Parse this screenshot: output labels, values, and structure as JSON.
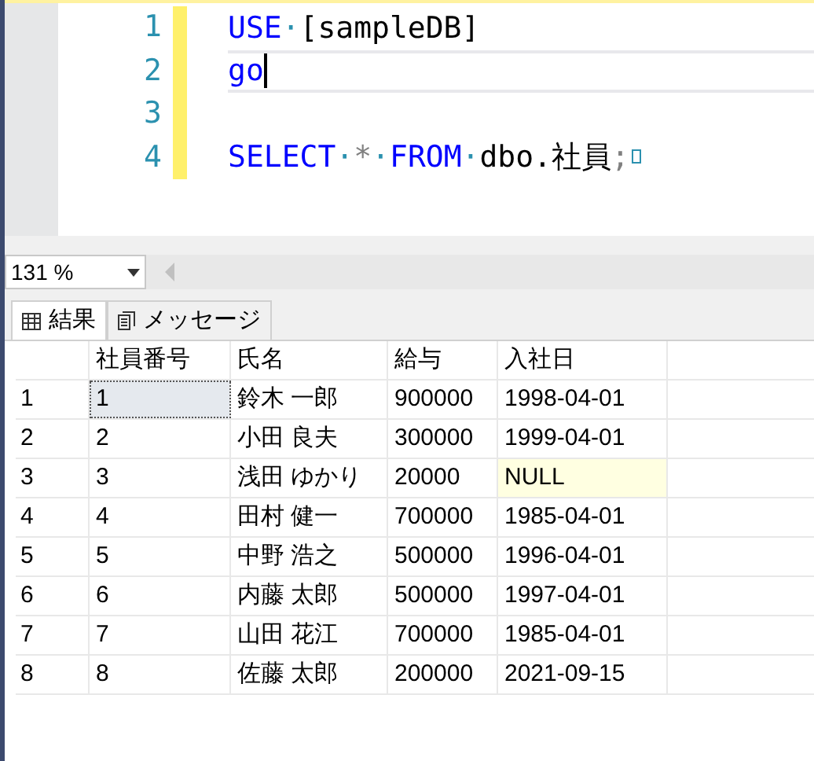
{
  "editor": {
    "lines": [
      {
        "number": "1",
        "caret": false,
        "tokens": [
          {
            "kind": "keyword",
            "text": "USE"
          },
          {
            "kind": "space",
            "text": "·"
          },
          {
            "kind": "plain",
            "text": "[sampleDB]"
          }
        ]
      },
      {
        "number": "2",
        "caret": true,
        "tokens": [
          {
            "kind": "keyword",
            "text": "go"
          }
        ]
      },
      {
        "number": "3",
        "caret": false
      },
      {
        "number": "4",
        "caret": false,
        "tokens": [
          {
            "kind": "keyword",
            "text": "SELECT"
          },
          {
            "kind": "space",
            "text": "·"
          },
          {
            "kind": "operator",
            "text": "*"
          },
          {
            "kind": "space",
            "text": "·"
          },
          {
            "kind": "keyword",
            "text": "FROM"
          },
          {
            "kind": "space",
            "text": "·"
          },
          {
            "kind": "plain",
            "text": "dbo.社員"
          },
          {
            "kind": "operator",
            "text": ";"
          },
          {
            "kind": "eol"
          }
        ]
      }
    ]
  },
  "zoom": {
    "value": "131 %"
  },
  "tabs": [
    {
      "label": "結果",
      "selected": true,
      "kind": "grid"
    },
    {
      "label": "メッセージ",
      "selected": false,
      "kind": "messages"
    }
  ],
  "table": {
    "columns": [
      "社員番号",
      "氏名",
      "給与",
      "入社日"
    ],
    "rows": [
      {
        "number": "1",
        "cells": [
          {
            "text": "1",
            "selected": true,
            "kind": "value"
          },
          {
            "text": "鈴木 一郎",
            "selected": false,
            "kind": "value"
          },
          {
            "text": "900000",
            "selected": false,
            "kind": "value"
          },
          {
            "text": "1998-04-01",
            "selected": false,
            "kind": "value"
          }
        ]
      },
      {
        "number": "2",
        "cells": [
          {
            "text": "2",
            "selected": false,
            "kind": "value"
          },
          {
            "text": "小田 良夫",
            "selected": false,
            "kind": "value"
          },
          {
            "text": "300000",
            "selected": false,
            "kind": "value"
          },
          {
            "text": "1999-04-01",
            "selected": false,
            "kind": "value"
          }
        ]
      },
      {
        "number": "3",
        "cells": [
          {
            "text": "3",
            "selected": false,
            "kind": "value"
          },
          {
            "text": "浅田 ゆかり",
            "selected": false,
            "kind": "value"
          },
          {
            "text": "20000",
            "selected": false,
            "kind": "value"
          },
          {
            "text": "NULL",
            "selected": false,
            "kind": "null"
          }
        ]
      },
      {
        "number": "4",
        "cells": [
          {
            "text": "4",
            "selected": false,
            "kind": "value"
          },
          {
            "text": "田村 健一",
            "selected": false,
            "kind": "value"
          },
          {
            "text": "700000",
            "selected": false,
            "kind": "value"
          },
          {
            "text": "1985-04-01",
            "selected": false,
            "kind": "value"
          }
        ]
      },
      {
        "number": "5",
        "cells": [
          {
            "text": "5",
            "selected": false,
            "kind": "value"
          },
          {
            "text": "中野 浩之",
            "selected": false,
            "kind": "value"
          },
          {
            "text": "500000",
            "selected": false,
            "kind": "value"
          },
          {
            "text": "1996-04-01",
            "selected": false,
            "kind": "value"
          }
        ]
      },
      {
        "number": "6",
        "cells": [
          {
            "text": "6",
            "selected": false,
            "kind": "value"
          },
          {
            "text": "内藤 太郎",
            "selected": false,
            "kind": "value"
          },
          {
            "text": "500000",
            "selected": false,
            "kind": "value"
          },
          {
            "text": "1997-04-01",
            "selected": false,
            "kind": "value"
          }
        ]
      },
      {
        "number": "7",
        "cells": [
          {
            "text": "7",
            "selected": false,
            "kind": "value"
          },
          {
            "text": "山田 花江",
            "selected": false,
            "kind": "value"
          },
          {
            "text": "700000",
            "selected": false,
            "kind": "value"
          },
          {
            "text": "1985-04-01",
            "selected": false,
            "kind": "value"
          }
        ]
      },
      {
        "number": "8",
        "cells": [
          {
            "text": "8",
            "selected": false,
            "kind": "value"
          },
          {
            "text": "佐藤 太郎",
            "selected": false,
            "kind": "value"
          },
          {
            "text": "200000",
            "selected": false,
            "kind": "value"
          },
          {
            "text": "2021-09-15",
            "selected": false,
            "kind": "value"
          }
        ]
      }
    ]
  }
}
